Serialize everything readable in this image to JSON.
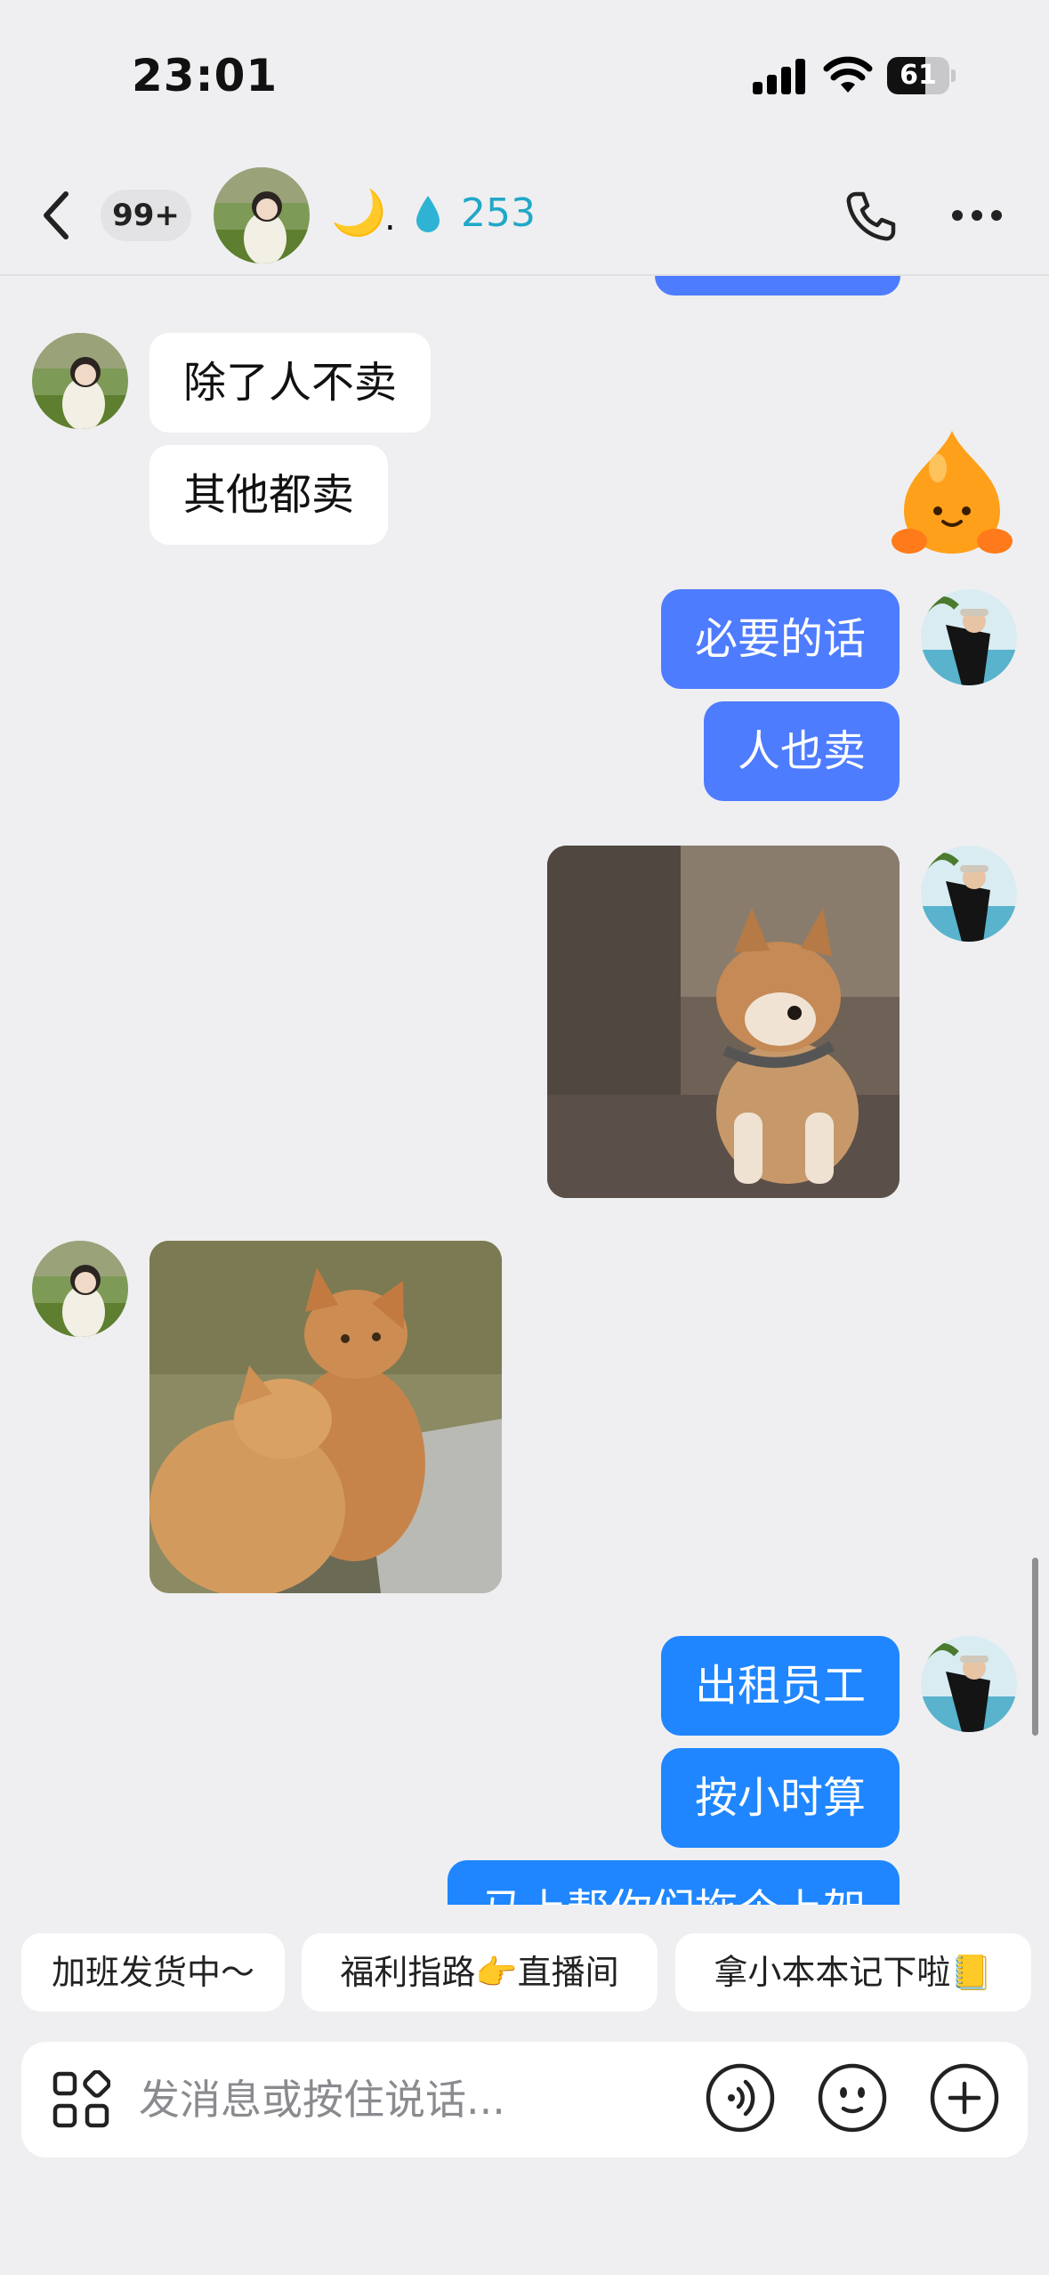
{
  "status_bar": {
    "time": "23:01",
    "battery": "61",
    "battery_level": 0.61
  },
  "header": {
    "unread_badge": "99+",
    "moon_emoji": "🌙",
    "separator": ".",
    "fire_count": "253",
    "icons": {
      "back": "back-chevron-icon",
      "call": "phone-icon",
      "more": "more-icon",
      "streak": "water-drop-icon"
    }
  },
  "messages": [
    {
      "side": "in",
      "type": "text",
      "text": "除了人不卖"
    },
    {
      "side": "in",
      "type": "text",
      "text": "其他都卖"
    },
    {
      "side": "out",
      "type": "sticker",
      "sticker": "orange-blob-sticker"
    },
    {
      "side": "out",
      "type": "text",
      "text": "必要的话"
    },
    {
      "side": "out",
      "type": "text",
      "text": "人也卖"
    },
    {
      "side": "out",
      "type": "image",
      "image": "shiba-dog-photo"
    },
    {
      "side": "in",
      "type": "image",
      "image": "orange-cats-photo"
    },
    {
      "side": "out",
      "type": "text",
      "text": "出租员工"
    },
    {
      "side": "out",
      "type": "text",
      "text": "按小时算"
    },
    {
      "side": "out",
      "type": "text",
      "text": "马上帮你们拖个上架"
    }
  ],
  "quick_replies": [
    "加班发货中～",
    "福利指路👉直播间",
    "拿小本本记下啦📒"
  ],
  "input": {
    "placeholder": "发消息或按住说话...",
    "icons": [
      "apps-grid-icon",
      "voice-icon",
      "emoji-icon",
      "plus-icon"
    ]
  },
  "colors": {
    "outgoing_bubble": "#4e7cff",
    "outgoing_bubble_alt": "#1f86ff",
    "incoming_bubble": "#ffffff",
    "background": "#efeff1",
    "fire_count": "#21a8c7"
  }
}
